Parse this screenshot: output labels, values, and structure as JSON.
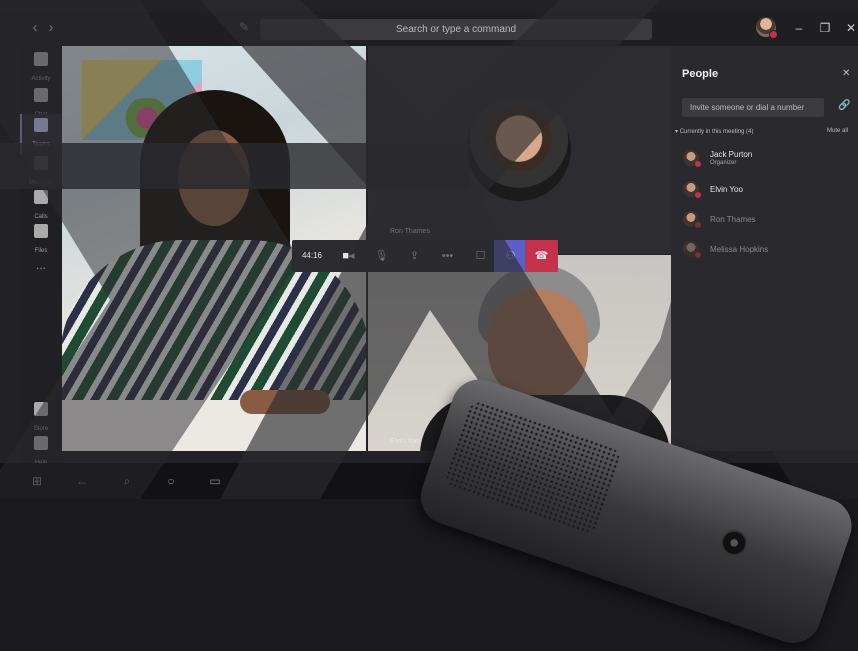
{
  "titlebar": {
    "search_placeholder": "Search or type a command",
    "back_icon": "chevron-left-icon",
    "forward_icon": "chevron-right-icon",
    "compose_icon": "compose-icon"
  },
  "rail": {
    "items": [
      {
        "label": "Activity",
        "icon": "bell-icon"
      },
      {
        "label": "Chat",
        "icon": "chat-icon"
      },
      {
        "label": "Teams",
        "icon": "teams-icon",
        "active": true
      },
      {
        "label": "Meetings",
        "icon": "calendar-icon"
      },
      {
        "label": "Calls",
        "icon": "phone-icon"
      },
      {
        "label": "Files",
        "icon": "file-icon"
      }
    ],
    "more": "...",
    "bottom": [
      {
        "label": "Store",
        "icon": "store-icon"
      },
      {
        "label": "Help",
        "icon": "help-icon"
      }
    ]
  },
  "stage": {
    "tiles": [
      {
        "name": "Melissa Hopkins"
      },
      {
        "name": "Ron Thames"
      },
      {
        "name": "Elvin Yoo"
      }
    ]
  },
  "controls": {
    "timer": "44:16",
    "buttons": [
      {
        "icon": "video-camera-icon"
      },
      {
        "icon": "microphone-icon"
      },
      {
        "icon": "share-screen-icon"
      },
      {
        "icon": "more-icon"
      },
      {
        "icon": "chat-icon"
      },
      {
        "icon": "participants-icon"
      },
      {
        "icon": "hang-up-icon"
      }
    ],
    "colors": {
      "participants_active": "#5b5fc7",
      "hang_up": "#c4314b"
    }
  },
  "people_panel": {
    "title": "People",
    "invite_placeholder": "Invite someone or dial a number",
    "section_label": "Currently in this meeting (4)",
    "mute_all": "Mute all",
    "participants": [
      {
        "name": "Jack Purton",
        "role": "Organizer"
      },
      {
        "name": "Elvin Yoo",
        "role": ""
      },
      {
        "name": "Ron Thames",
        "role": ""
      },
      {
        "name": "Melissa Hopkins",
        "role": ""
      }
    ]
  },
  "taskbar": {
    "icons": [
      "windows-start-icon",
      "back-arrow-icon",
      "search-icon",
      "cortana-icon",
      "task-view-icon"
    ]
  }
}
